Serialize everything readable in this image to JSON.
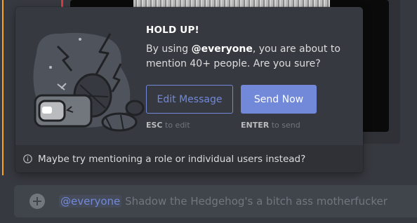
{
  "popup": {
    "title": "HOLD UP!",
    "desc_prefix": "By using ",
    "mention_word": "@everyone",
    "desc_suffix": ", you are about to mention 40+ people. Are you sure?",
    "edit_button": "Edit Message",
    "send_button": "Send Now",
    "edit_hint_key": "ESC",
    "edit_hint_text": " to edit",
    "send_hint_key": "ENTER",
    "send_hint_text": " to send",
    "footer_text": "Maybe try mentioning a role or individual users instead?"
  },
  "chat_input": {
    "mention": "@everyone",
    "message": " Shadow the Hedgehog's a bitch ass motherfucker"
  },
  "colors": {
    "blurple": "#7289da",
    "background": "#36393f",
    "footer": "#2f3136",
    "input": "#40444b"
  },
  "icons": {
    "info": "info-icon",
    "plus": "plus-icon",
    "illustration": "broken-vr-headset-illustration"
  }
}
